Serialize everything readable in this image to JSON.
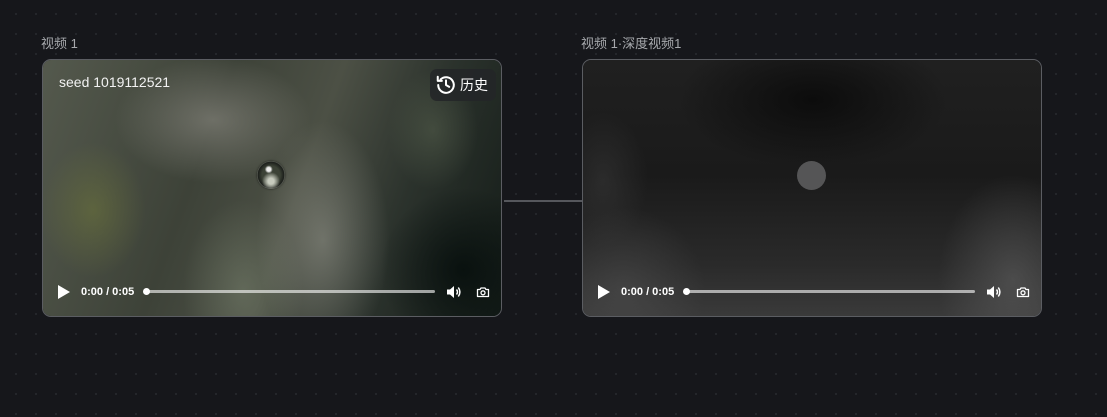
{
  "nodes": [
    {
      "title": "视频 1",
      "seed_label": "seed 1019112521",
      "history_label": "历史",
      "time": "0:00 / 0:05",
      "progress": 0
    },
    {
      "title": "视频 1·深度视频1",
      "time": "0:00 / 0:05",
      "progress": 0
    }
  ],
  "icons": {
    "history": "history-clock-icon",
    "play": "play-icon",
    "volume": "volume-icon",
    "snapshot": "camera-icon"
  },
  "colors": {
    "background": "#16171b",
    "node_border": "#5b5d62",
    "connector": "#55575c"
  }
}
